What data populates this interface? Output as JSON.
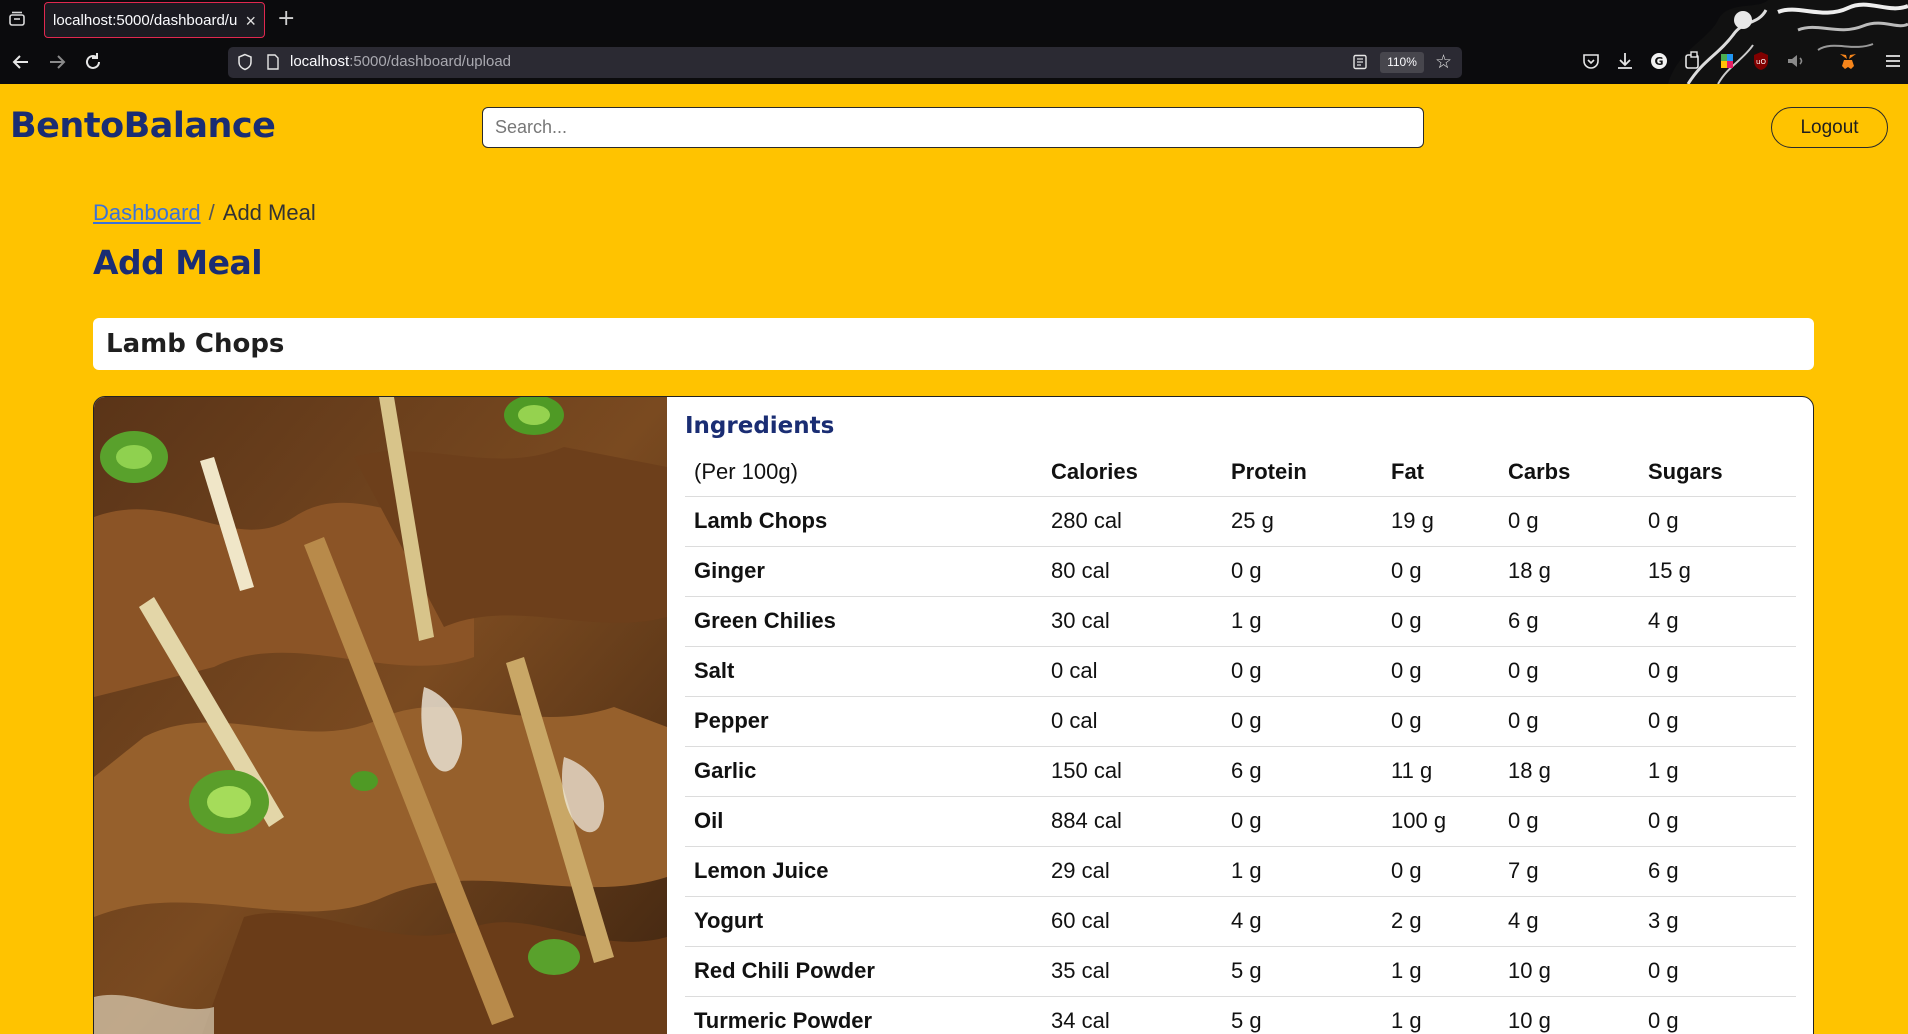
{
  "browser": {
    "tab_title": "localhost:5000/dashboard/u",
    "url_host": "localhost",
    "url_path": ":5000/dashboard/upload",
    "zoom": "110%"
  },
  "header": {
    "brand": "BentoBalance",
    "search_placeholder": "Search...",
    "logout_label": "Logout"
  },
  "breadcrumb": {
    "link": "Dashboard",
    "separator": "/",
    "current": "Add Meal"
  },
  "page_title": "Add Meal",
  "meal": {
    "name": "Lamb Chops"
  },
  "ingredients": {
    "title": "Ingredients",
    "columns": [
      "(Per 100g)",
      "Calories",
      "Protein",
      "Fat",
      "Carbs",
      "Sugars"
    ],
    "rows": [
      {
        "name": "Lamb Chops",
        "calories": "280 cal",
        "protein": "25 g",
        "fat": "19 g",
        "carbs": "0 g",
        "sugars": "0 g"
      },
      {
        "name": "Ginger",
        "calories": "80 cal",
        "protein": "0 g",
        "fat": "0 g",
        "carbs": "18 g",
        "sugars": "15 g"
      },
      {
        "name": "Green Chilies",
        "calories": "30 cal",
        "protein": "1 g",
        "fat": "0 g",
        "carbs": "6 g",
        "sugars": "4 g"
      },
      {
        "name": "Salt",
        "calories": "0 cal",
        "protein": "0 g",
        "fat": "0 g",
        "carbs": "0 g",
        "sugars": "0 g"
      },
      {
        "name": "Pepper",
        "calories": "0 cal",
        "protein": "0 g",
        "fat": "0 g",
        "carbs": "0 g",
        "sugars": "0 g"
      },
      {
        "name": "Garlic",
        "calories": "150 cal",
        "protein": "6 g",
        "fat": "11 g",
        "carbs": "18 g",
        "sugars": "1 g"
      },
      {
        "name": "Oil",
        "calories": "884 cal",
        "protein": "0 g",
        "fat": "100 g",
        "carbs": "0 g",
        "sugars": "0 g"
      },
      {
        "name": "Lemon Juice",
        "calories": "29 cal",
        "protein": "1 g",
        "fat": "0 g",
        "carbs": "7 g",
        "sugars": "6 g"
      },
      {
        "name": "Yogurt",
        "calories": "60 cal",
        "protein": "4 g",
        "fat": "2 g",
        "carbs": "4 g",
        "sugars": "3 g"
      },
      {
        "name": "Red Chili Powder",
        "calories": "35 cal",
        "protein": "5 g",
        "fat": "1 g",
        "carbs": "10 g",
        "sugars": "0 g"
      },
      {
        "name": "Turmeric Powder",
        "calories": "34 cal",
        "protein": "5 g",
        "fat": "1 g",
        "carbs": "10 g",
        "sugars": "0 g"
      }
    ]
  },
  "colors": {
    "page_bg": "#FFC300",
    "brand_navy": "#1a2d73",
    "link_blue": "#3b72d9",
    "tab_border": "#e0284f"
  },
  "icons": [
    "tab-list-icon",
    "close-icon",
    "plus-icon",
    "back-arrow-icon",
    "forward-arrow-icon",
    "reload-icon",
    "shield-icon",
    "page-icon",
    "reader-view-icon",
    "bookmark-star-icon",
    "pocket-icon",
    "download-icon",
    "grammarly-icon",
    "extension-icon",
    "color-extension-icon",
    "ublock-icon",
    "speaker-icon",
    "metamask-icon",
    "menu-icon"
  ]
}
